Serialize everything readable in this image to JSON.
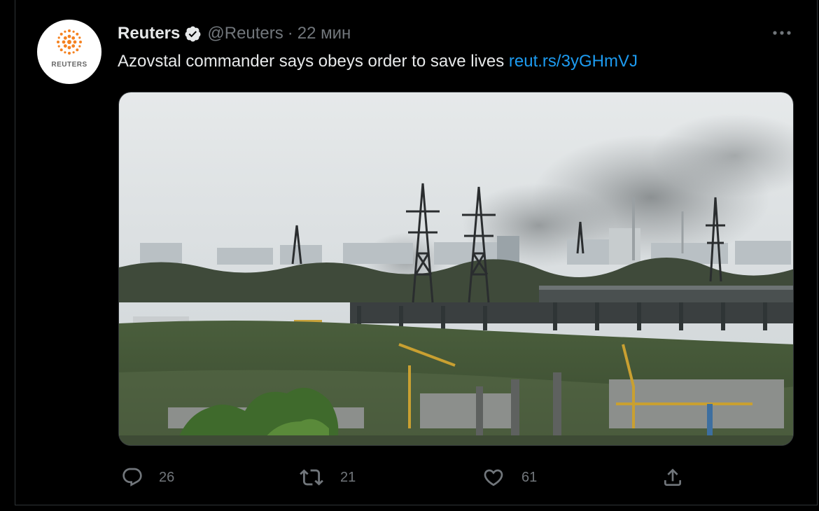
{
  "tweet": {
    "author_name": "Reuters",
    "handle": "@Reuters",
    "separator": "·",
    "time": "22 мин",
    "text": "Azovstal commander says obeys order to save lives",
    "link": "reut.rs/3yGHmVJ",
    "avatar_wordmark": "REUTERS",
    "more_icon": "more-dots-icon",
    "verified_icon": "verified-badge-icon"
  },
  "actions": {
    "reply_count": "26",
    "retweet_count": "21",
    "like_count": "61"
  },
  "colors": {
    "background": "#000000",
    "text_primary": "#e7e9ea",
    "text_secondary": "#71767b",
    "link": "#1d9bf0",
    "border": "#2f3336",
    "reuters_orange": "#f58220"
  }
}
